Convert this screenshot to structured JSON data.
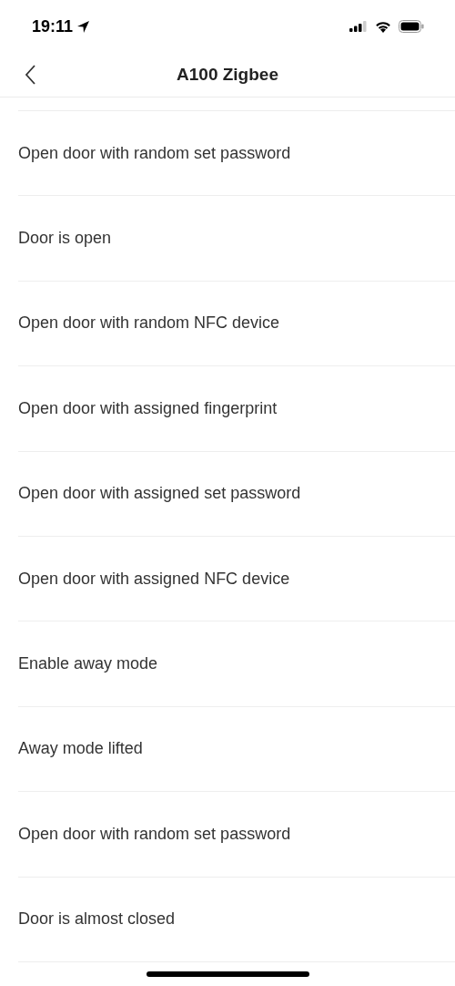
{
  "status_bar": {
    "time": "19:11"
  },
  "header": {
    "title": "A100 Zigbee"
  },
  "events": [
    {
      "label": "Open door with random set password"
    },
    {
      "label": "Door is open"
    },
    {
      "label": "Open door with random NFC device"
    },
    {
      "label": "Open door with assigned fingerprint"
    },
    {
      "label": "Open door with assigned set password"
    },
    {
      "label": "Open door with assigned NFC device"
    },
    {
      "label": "Enable away mode"
    },
    {
      "label": "Away mode lifted"
    },
    {
      "label": "Open door with random set password"
    },
    {
      "label": "Door is almost closed"
    }
  ]
}
